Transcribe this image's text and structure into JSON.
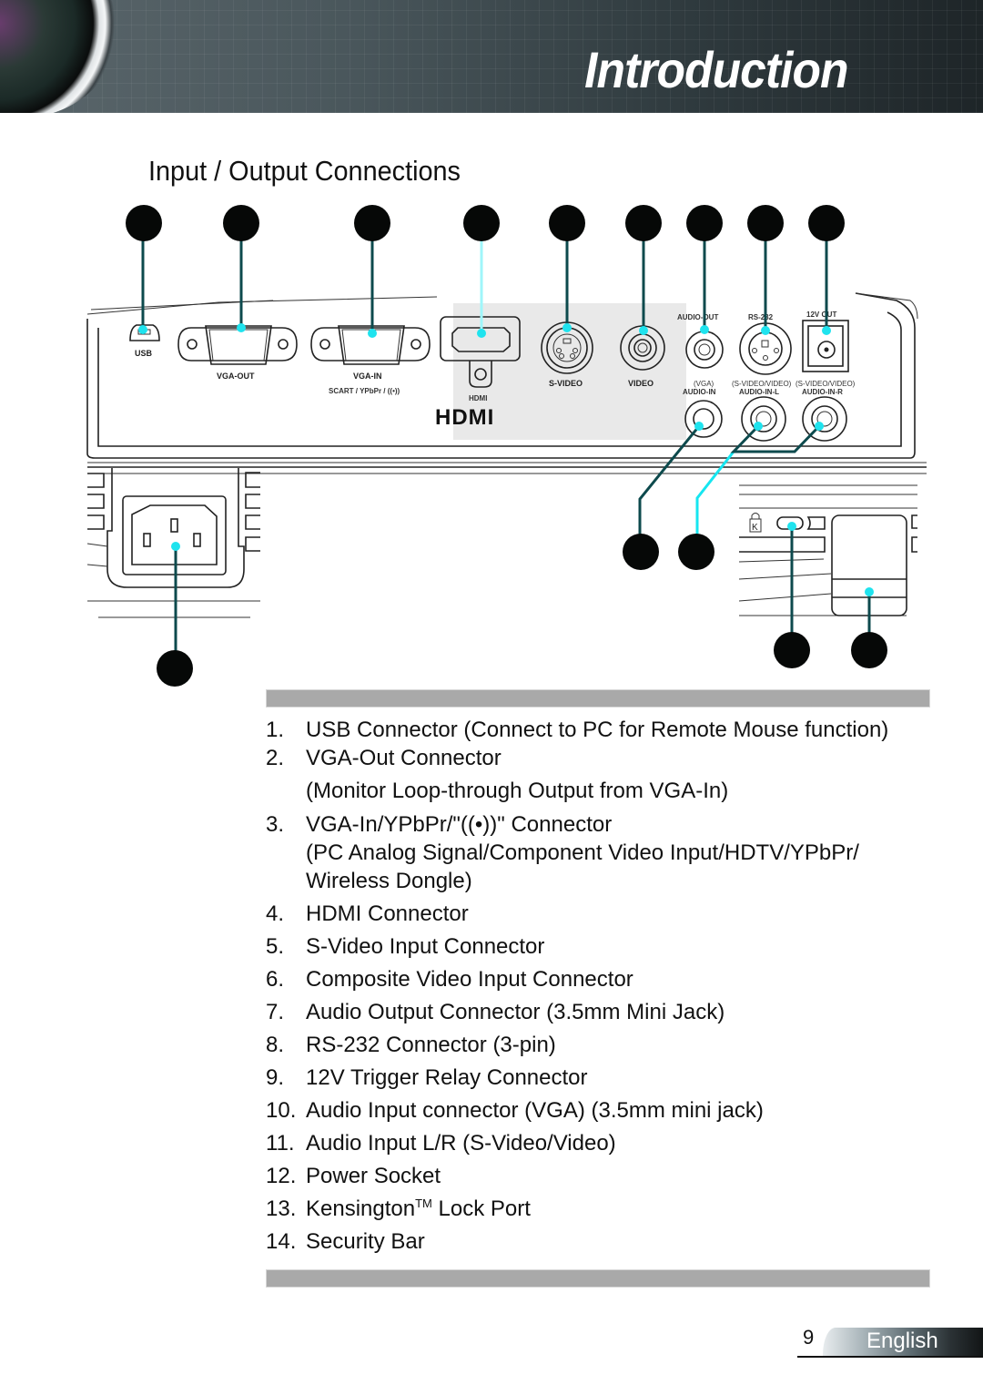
{
  "header": {
    "title": "Introduction"
  },
  "section": {
    "title": "Input / Output Connections"
  },
  "diagram": {
    "port_labels": {
      "usb": "USB",
      "vga_out": "VGA-OUT",
      "vga_in": "VGA-IN",
      "vga_in_sub": "SCART / YPbPr / ((•))",
      "hdmi": "HDMI",
      "hdmi_logo": "HDMI",
      "s_video": "S-VIDEO",
      "video": "VIDEO",
      "audio_out": "AUDIO-OUT",
      "rs232": "RS-232",
      "v12_out": "12V OUT",
      "audio_in_vga_note": "(VGA)",
      "audio_in": "AUDIO-IN",
      "audio_lr_note": "(S-VIDEO/VIDEO)",
      "audio_in_l": "AUDIO-IN-L",
      "audio_in_r": "AUDIO-IN-R"
    },
    "callout_count": 14
  },
  "legend": {
    "items": [
      {
        "num": "1.",
        "text": "USB Connector (Connect to PC for Remote Mouse function)"
      },
      {
        "num": "2.",
        "text": "VGA-Out Connector",
        "sub": "(Monitor Loop-through Output from VGA-In)"
      },
      {
        "num": "3.",
        "text": "VGA-In/YPbPr/\"((•))\" Connector",
        "sub": "(PC Analog Signal/Component Video Input/HDTV/YPbPr/",
        "sub2": "Wireless Dongle)"
      },
      {
        "num": "4.",
        "text": "HDMI Connector"
      },
      {
        "num": "5.",
        "text": "S-Video Input Connector"
      },
      {
        "num": "6.",
        "text": "Composite Video Input Connector"
      },
      {
        "num": "7.",
        "text": "Audio Output Connector (3.5mm Mini Jack)"
      },
      {
        "num": "8.",
        "text": "RS-232 Connector (3-pin)"
      },
      {
        "num": "9.",
        "text": "12V Trigger Relay Connector"
      },
      {
        "num": "10.",
        "text": "Audio Input connector (VGA) (3.5mm mini jack)"
      },
      {
        "num": "11.",
        "text": "Audio Input L/R (S-Video/Video)"
      },
      {
        "num": "12.",
        "text": "Power Socket"
      },
      {
        "num": "13.",
        "text": "Kensington",
        "tm": "TM",
        "text_after": " Lock Port"
      },
      {
        "num": "14.",
        "text": "Security Bar"
      }
    ]
  },
  "footer": {
    "page_number": "9",
    "language": "English"
  }
}
